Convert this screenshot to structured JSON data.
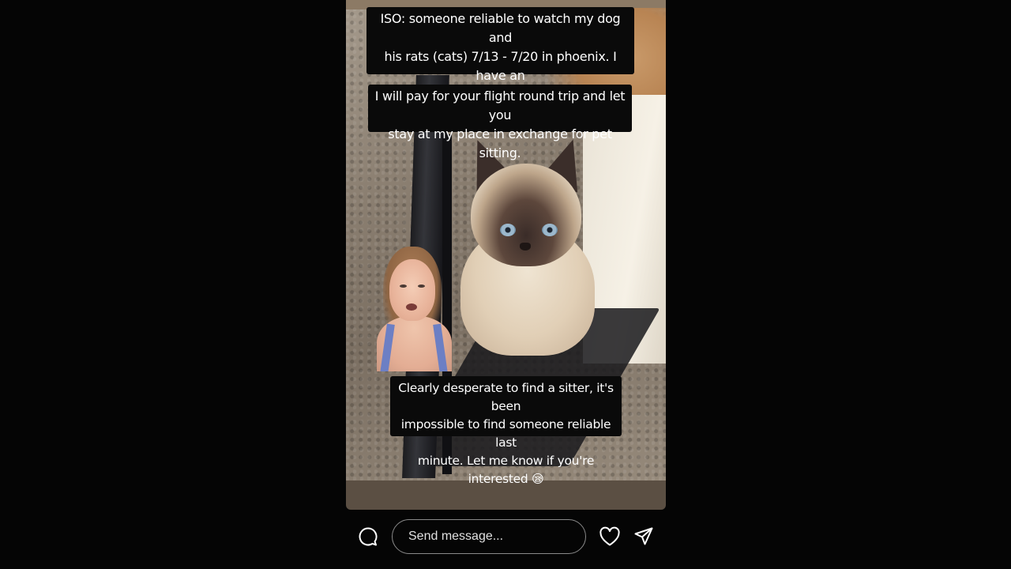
{
  "story": {
    "captions": [
      "ISO: someone reliable to watch my dog and\nhis rats (cats) 7/13 - 7/20 in phoenix. I have an\nemergency trip I need to make home.",
      "I will pay for your flight round trip and let you\nstay at my place in exchange for pet sitting.",
      "Clearly desperate to find a sitter, it's been\nimpossible to find someone reliable last\nminute. Let me know if you're interested"
    ],
    "caption_3_emoji": "😪",
    "photo_subject": "siamese-cat",
    "inset_subject": "person-face"
  },
  "footer": {
    "message_placeholder": "Send message...",
    "icons": {
      "comment": "comment-icon",
      "like": "heart-icon",
      "share": "send-icon"
    }
  },
  "colors": {
    "background": "#050505",
    "caption_bg": "#0a0a0a",
    "caption_text": "#ffffff",
    "input_border": "#8a8a8a"
  }
}
